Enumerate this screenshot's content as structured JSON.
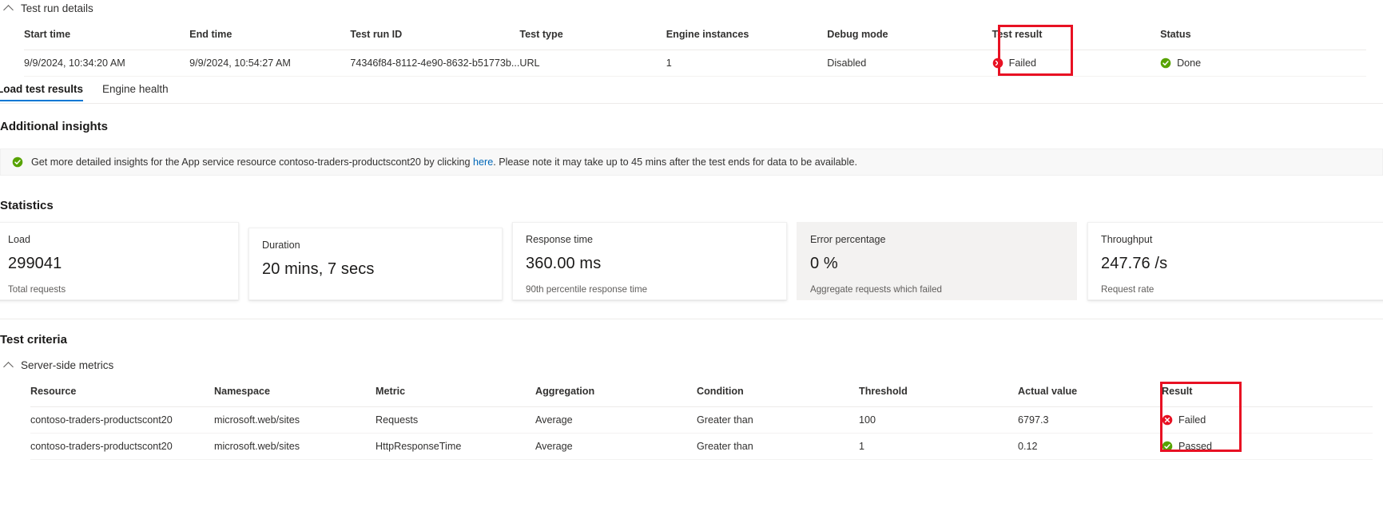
{
  "page": {
    "run_details_section_label": "Test run details",
    "statistics_heading": "Statistics",
    "additional_insights_heading": "Additional insights",
    "test_criteria_heading": "Test criteria",
    "server_side_metrics_label": "Server-side metrics",
    "accent_color": "#0078d4",
    "annotation_color": "#e81123",
    "fail_color": "#e81123",
    "pass_color": "#57a300"
  },
  "run_details": {
    "columns": [
      "Start time",
      "End time",
      "Test run ID",
      "Test type",
      "Engine instances",
      "Debug mode",
      "Test result",
      "Status"
    ],
    "rows": [
      {
        "start_time": "9/9/2024, 10:34:20 AM",
        "end_time": "9/9/2024, 10:54:27 AM",
        "test_run_id": "74346f84-8112-4e90-8632-b51773b...",
        "test_type": "URL",
        "engine_instances": "1",
        "debug_mode": "Disabled",
        "test_result": "Failed",
        "test_result_icon": "error-circle-icon",
        "status": "Done",
        "status_icon": "success-circle-icon"
      }
    ]
  },
  "tabs": [
    {
      "label": "Load test results",
      "selected": true
    },
    {
      "label": "Engine health",
      "selected": false
    }
  ],
  "insights_banner": {
    "icon": "success-circle-icon",
    "text_before_link": "Get more detailed insights for the App service resource contoso-traders-productscont20 by clicking ",
    "link_text": "here",
    "text_after_link": ". Please note it may take up to 45 mins after the test ends for data to be available."
  },
  "statistics": {
    "cards": [
      {
        "title": "Load",
        "value": "299041",
        "subtitle": "Total requests",
        "highlighted": false
      },
      {
        "title": "Duration",
        "value": "20 mins, 7 secs",
        "subtitle": "",
        "highlighted": false
      },
      {
        "title": "Response time",
        "value": "360.00 ms",
        "subtitle": "90th percentile response time",
        "highlighted": false
      },
      {
        "title": "Error percentage",
        "value": "0 %",
        "subtitle": "Aggregate requests which failed",
        "highlighted": true
      },
      {
        "title": "Throughput",
        "value": "247.76 /s",
        "subtitle": "Request rate",
        "highlighted": false
      }
    ]
  },
  "test_criteria": {
    "columns": [
      "Resource",
      "Namespace",
      "Metric",
      "Aggregation",
      "Condition",
      "Threshold",
      "Actual value",
      "Result"
    ],
    "rows": [
      {
        "resource": "contoso-traders-productscont20",
        "namespace": "microsoft.web/sites",
        "metric": "Requests",
        "aggregation": "Average",
        "condition": "Greater than",
        "threshold": "100",
        "actual_value": "6797.3",
        "result": "Failed",
        "result_icon": "error-circle-icon"
      },
      {
        "resource": "contoso-traders-productscont20",
        "namespace": "microsoft.web/sites",
        "metric": "HttpResponseTime",
        "aggregation": "Average",
        "condition": "Greater than",
        "threshold": "1",
        "actual_value": "0.12",
        "result": "Passed",
        "result_icon": "success-circle-icon"
      }
    ]
  }
}
